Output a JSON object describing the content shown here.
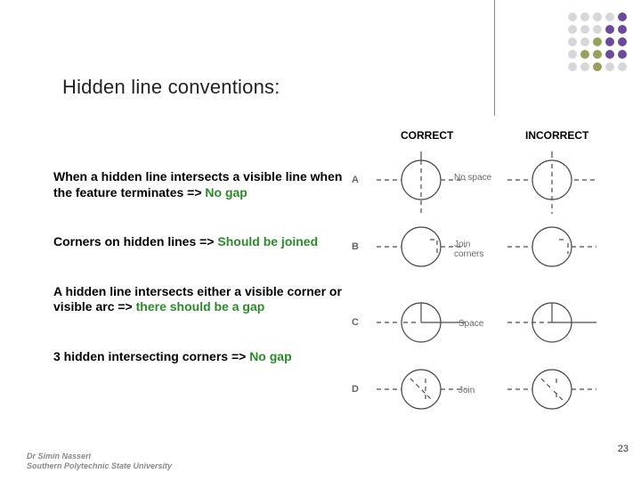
{
  "title": "Hidden line conventions:",
  "rules": {
    "a_pre": "When a hidden line intersects a visible line when the feature terminates => ",
    "a_emph": "No gap",
    "b_pre": "Corners on hidden lines => ",
    "b_emph": "Should be joined",
    "c_pre": "A hidden line intersects either a visible corner or visible arc => ",
    "c_emph": "there should be a gap",
    "d_pre": "3 hidden intersecting corners => ",
    "d_emph": "No gap"
  },
  "fig": {
    "correct": "CORRECT",
    "incorrect": "INCORRECT",
    "a": "A",
    "b": "B",
    "c": "C",
    "d": "D",
    "cap_a": "No space",
    "cap_b": "Join corners",
    "cap_c": "Space",
    "cap_d": "Join"
  },
  "footer": {
    "l1": "Dr Simin Nasseri",
    "l2": "Southern Polytechnic State University"
  },
  "page": "23"
}
